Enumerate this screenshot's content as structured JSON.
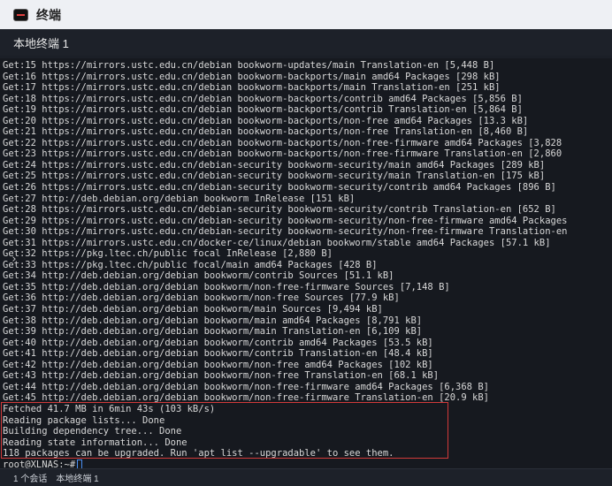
{
  "window": {
    "title": "终端"
  },
  "tab": {
    "label": "本地终端 1"
  },
  "terminal": {
    "lines": [
      "Get:15 https://mirrors.ustc.edu.cn/debian bookworm-updates/main Translation-en [5,448 B]",
      "Get:16 https://mirrors.ustc.edu.cn/debian bookworm-backports/main amd64 Packages [298 kB]",
      "Get:17 https://mirrors.ustc.edu.cn/debian bookworm-backports/main Translation-en [251 kB]",
      "Get:18 https://mirrors.ustc.edu.cn/debian bookworm-backports/contrib amd64 Packages [5,856 B]",
      "Get:19 https://mirrors.ustc.edu.cn/debian bookworm-backports/contrib Translation-en [5,864 B]",
      "Get:20 https://mirrors.ustc.edu.cn/debian bookworm-backports/non-free amd64 Packages [13.3 kB]",
      "Get:21 https://mirrors.ustc.edu.cn/debian bookworm-backports/non-free Translation-en [8,460 B]",
      "Get:22 https://mirrors.ustc.edu.cn/debian bookworm-backports/non-free-firmware amd64 Packages [3,828",
      "Get:23 https://mirrors.ustc.edu.cn/debian bookworm-backports/non-free-firmware Translation-en [2,860",
      "Get:24 https://mirrors.ustc.edu.cn/debian-security bookworm-security/main amd64 Packages [289 kB]",
      "Get:25 https://mirrors.ustc.edu.cn/debian-security bookworm-security/main Translation-en [175 kB]",
      "Get:26 https://mirrors.ustc.edu.cn/debian-security bookworm-security/contrib amd64 Packages [896 B]",
      "Get:27 http://deb.debian.org/debian bookworm InRelease [151 kB]",
      "Get:28 https://mirrors.ustc.edu.cn/debian-security bookworm-security/contrib Translation-en [652 B]",
      "Get:29 https://mirrors.ustc.edu.cn/debian-security bookworm-security/non-free-firmware amd64 Packages",
      "Get:30 https://mirrors.ustc.edu.cn/debian-security bookworm-security/non-free-firmware Translation-en",
      "Get:31 https://mirrors.ustc.edu.cn/docker-ce/linux/debian bookworm/stable amd64 Packages [57.1 kB]",
      "Get:32 https://pkg.ltec.ch/public focal InRelease [2,880 B]",
      "Get:33 https://pkg.ltec.ch/public focal/main amd64 Packages [428 B]",
      "Get:34 http://deb.debian.org/debian bookworm/contrib Sources [51.1 kB]",
      "Get:35 http://deb.debian.org/debian bookworm/non-free-firmware Sources [7,148 B]",
      "Get:36 http://deb.debian.org/debian bookworm/non-free Sources [77.9 kB]",
      "Get:37 http://deb.debian.org/debian bookworm/main Sources [9,494 kB]",
      "Get:38 http://deb.debian.org/debian bookworm/main amd64 Packages [8,791 kB]",
      "Get:39 http://deb.debian.org/debian bookworm/main Translation-en [6,109 kB]",
      "Get:40 http://deb.debian.org/debian bookworm/contrib amd64 Packages [53.5 kB]",
      "Get:41 http://deb.debian.org/debian bookworm/contrib Translation-en [48.4 kB]",
      "Get:42 http://deb.debian.org/debian bookworm/non-free amd64 Packages [102 kB]",
      "Get:43 http://deb.debian.org/debian bookworm/non-free Translation-en [68.1 kB]",
      "Get:44 http://deb.debian.org/debian bookworm/non-free-firmware amd64 Packages [6,368 B]",
      "Get:45 http://deb.debian.org/debian bookworm/non-free-firmware Translation-en [20.9 kB]",
      "Fetched 41.7 MB in 6min 43s (103 kB/s)",
      "Reading package lists... Done",
      "Building dependency tree... Done",
      "Reading state information... Done",
      "118 packages can be upgraded. Run 'apt list --upgradable' to see them."
    ],
    "prompt": "root@XLNAS:~#",
    "side_handle_icon": "chevron-right-icon"
  },
  "status": {
    "session_count": "1 个会话",
    "session_name": "本地终端 1"
  },
  "colors": {
    "highlight_border": "#d23a3a",
    "cursor": "#4a8ef0",
    "terminal_bg": "#16191f"
  }
}
